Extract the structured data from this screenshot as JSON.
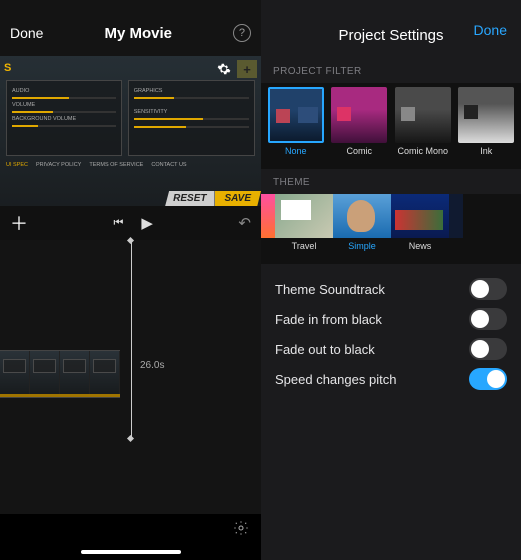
{
  "left": {
    "header": {
      "done": "Done",
      "title": "My Movie"
    },
    "preview": {
      "badge": "S",
      "panelLeft": {
        "l1": "AUDIO",
        "l2": "VOLUME",
        "l3": "BACKGROUND VOLUME"
      },
      "panelRight": {
        "l1": "GRAPHICS",
        "l2": "SENSITIVITY"
      },
      "tabs": [
        "UI SPEC",
        "PRIVACY POLICY",
        "TERMS OF SERVICE",
        "CONTACT US"
      ],
      "reset": "RESET",
      "save": "SAVE"
    },
    "timeline": {
      "duration": "26.0s"
    }
  },
  "right": {
    "header": {
      "title": "Project Settings",
      "done": "Done"
    },
    "sections": {
      "filter": "PROJECT FILTER",
      "theme": "THEME"
    },
    "filters": [
      {
        "label": "None",
        "selected": true
      },
      {
        "label": "Comic",
        "selected": false
      },
      {
        "label": "Comic Mono",
        "selected": false
      },
      {
        "label": "Ink",
        "selected": false
      }
    ],
    "themes": [
      {
        "label": "Travel",
        "selected": false
      },
      {
        "label": "Simple",
        "selected": true
      },
      {
        "label": "News",
        "selected": false
      }
    ],
    "toggles": [
      {
        "label": "Theme Soundtrack",
        "on": false
      },
      {
        "label": "Fade in from black",
        "on": false
      },
      {
        "label": "Fade out to black",
        "on": false
      },
      {
        "label": "Speed changes pitch",
        "on": true
      }
    ]
  }
}
